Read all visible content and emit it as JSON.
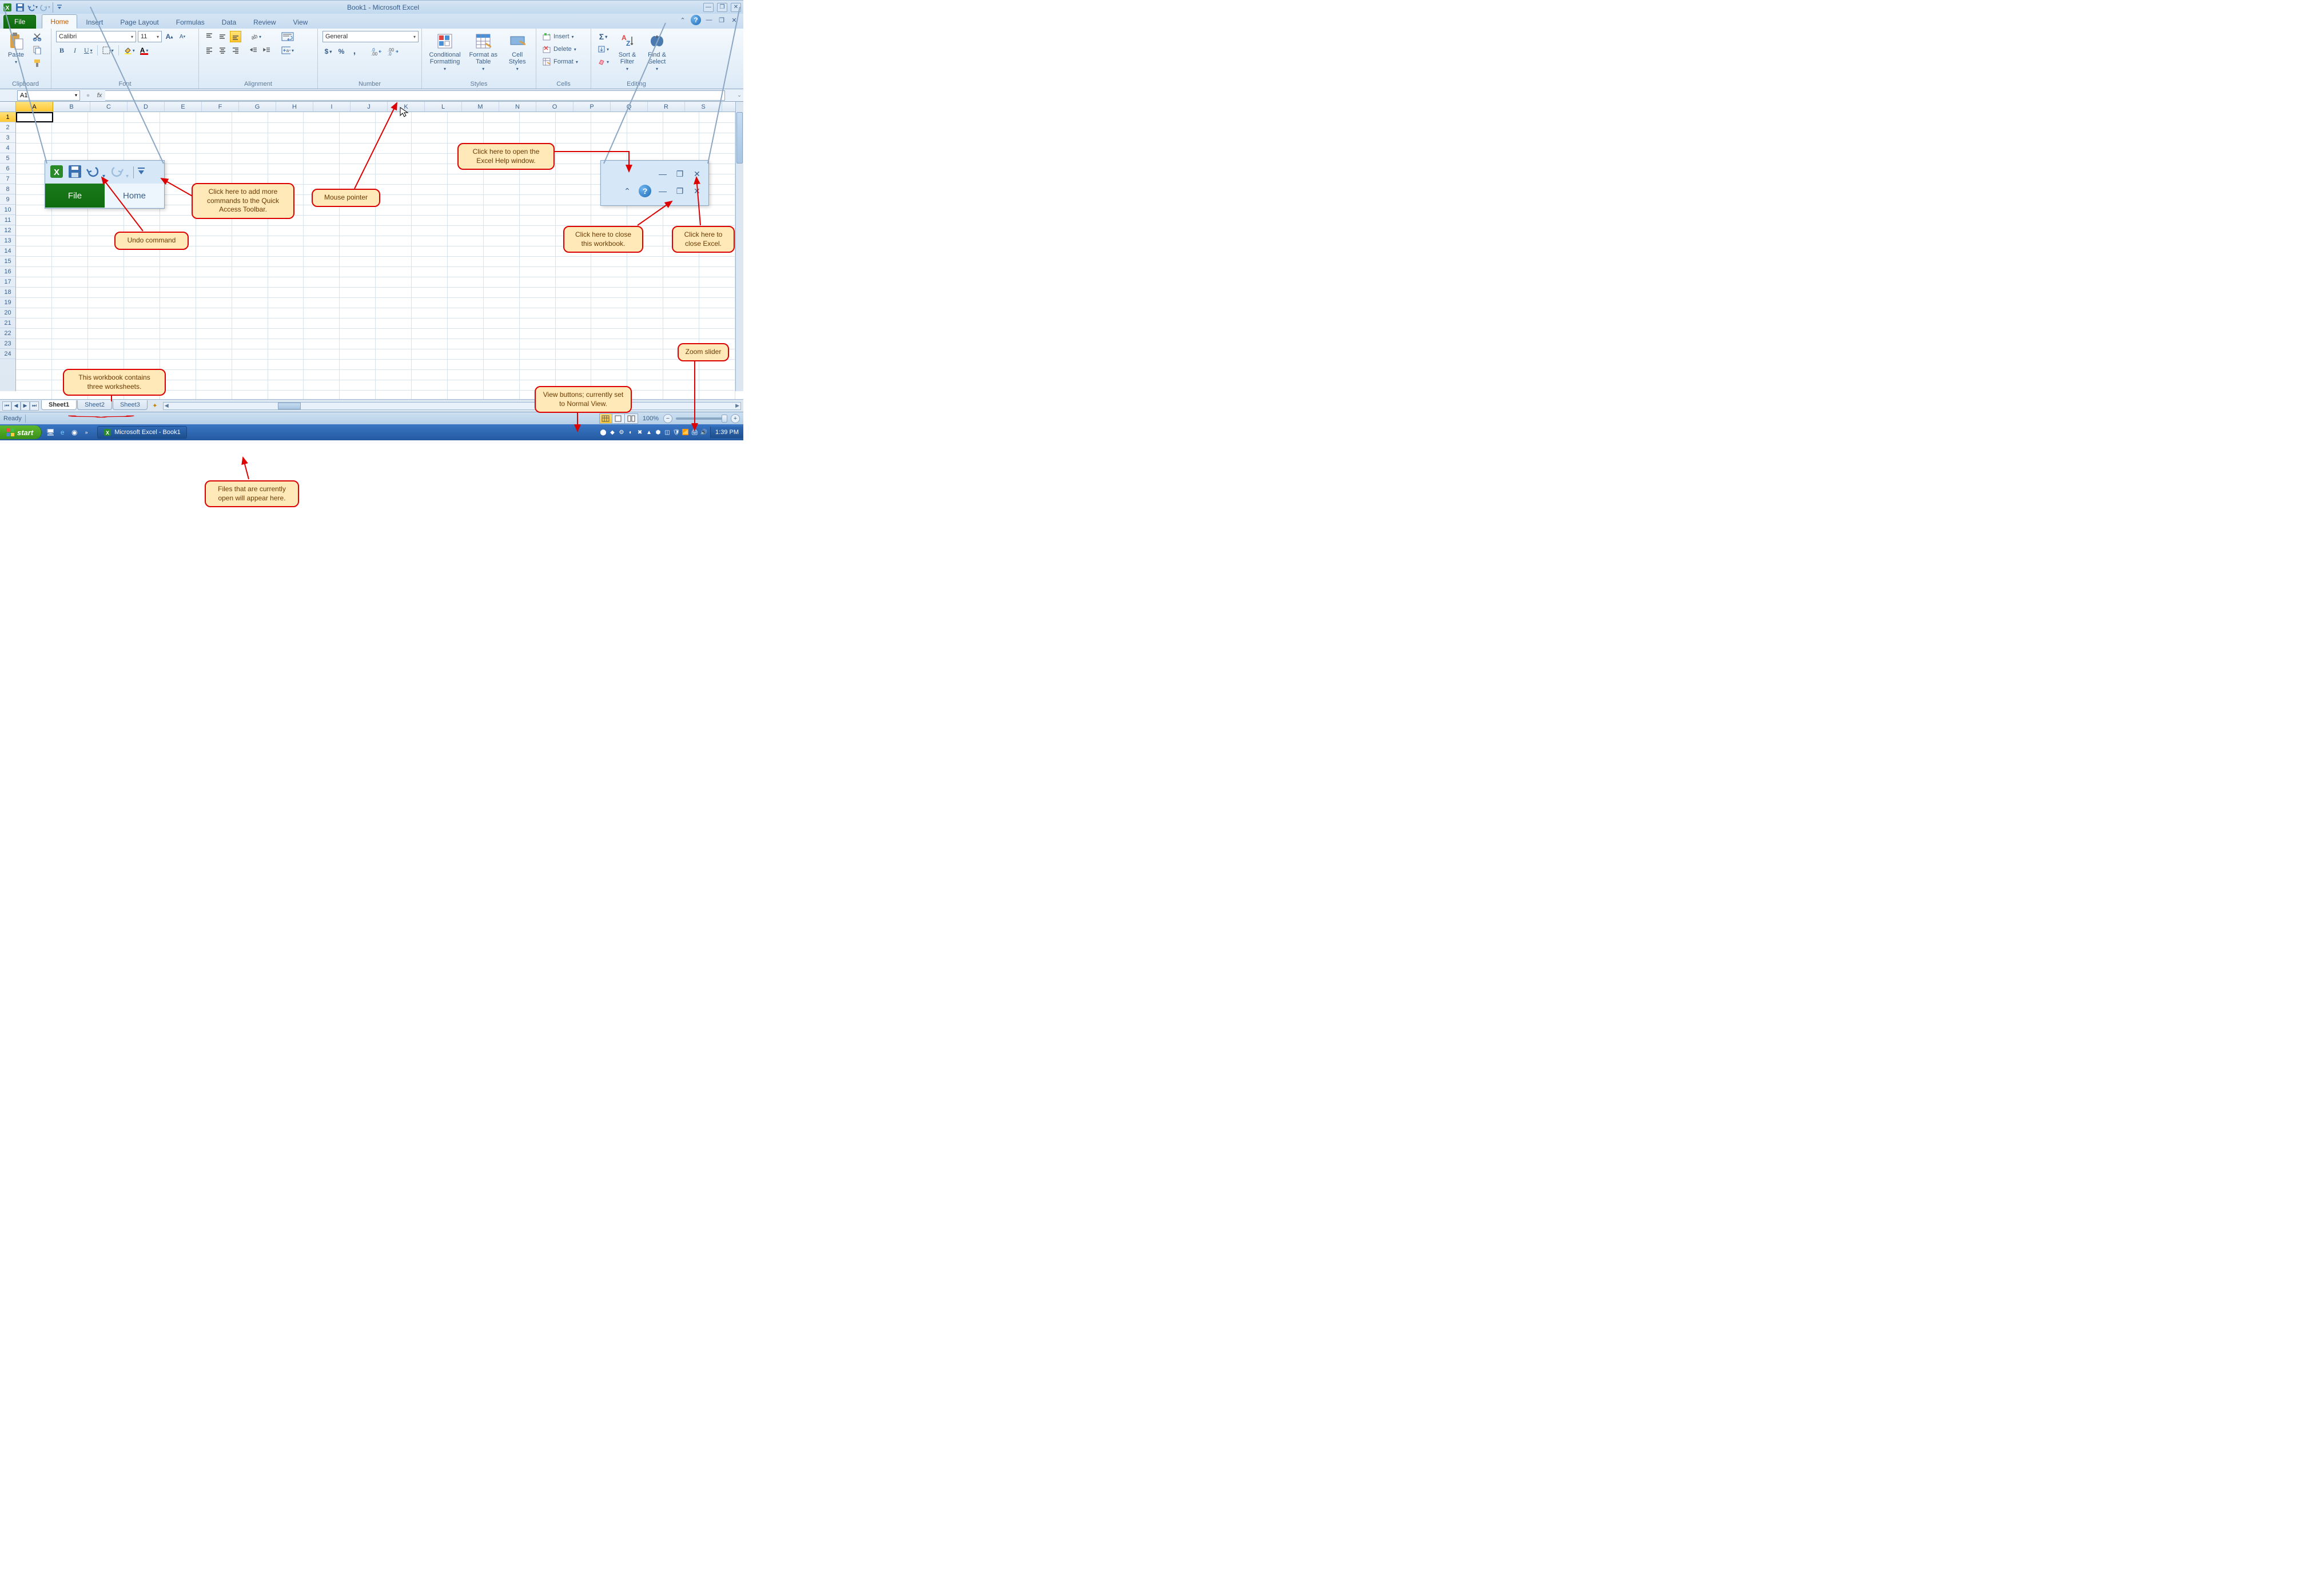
{
  "title": "Book1 - Microsoft Excel",
  "qat": {
    "save": "save-icon",
    "undo": "undo-icon",
    "redo": "redo-icon",
    "customize": "customize-qat-icon"
  },
  "tabs": {
    "file": "File",
    "items": [
      "Home",
      "Insert",
      "Page Layout",
      "Formulas",
      "Data",
      "Review",
      "View"
    ],
    "active": "Home"
  },
  "ribbon": {
    "clipboard": {
      "label": "Clipboard",
      "paste": "Paste"
    },
    "font": {
      "label": "Font",
      "name": "Calibri",
      "size": "11"
    },
    "alignment": {
      "label": "Alignment"
    },
    "number": {
      "label": "Number",
      "format": "General"
    },
    "styles": {
      "label": "Styles",
      "conditional": "Conditional Formatting",
      "table": "Format as Table",
      "cell": "Cell Styles"
    },
    "cells": {
      "label": "Cells",
      "insert": "Insert",
      "delete": "Delete",
      "format": "Format"
    },
    "editing": {
      "label": "Editing",
      "sort": "Sort & Filter",
      "find": "Find & Select"
    }
  },
  "namebox": "A1",
  "columns": [
    "A",
    "B",
    "C",
    "D",
    "E",
    "F",
    "G",
    "H",
    "I",
    "J",
    "K",
    "L",
    "M",
    "N",
    "O",
    "P",
    "Q",
    "R",
    "S"
  ],
  "rows": [
    "1",
    "2",
    "3",
    "4",
    "5",
    "6",
    "7",
    "8",
    "9",
    "10",
    "11",
    "12",
    "13",
    "14",
    "15",
    "16",
    "17",
    "18",
    "19",
    "20",
    "21",
    "22",
    "23",
    "24"
  ],
  "sheets": {
    "active": "Sheet1",
    "tabs": [
      "Sheet1",
      "Sheet2",
      "Sheet3"
    ]
  },
  "status": {
    "ready": "Ready",
    "zoom": "100%"
  },
  "taskbar": {
    "start": "start",
    "task": "Microsoft Excel - Book1",
    "clock": "1:39 PM"
  },
  "callouts": {
    "qat_customize": "Click here to add more commands to the Quick Access Toolbar.",
    "undo": "Undo command",
    "mouse": "Mouse pointer",
    "help": "Click here to open the Excel Help window.",
    "close_wb": "Click here to close this workbook.",
    "close_app": "Click here to close Excel.",
    "zoom": "Zoom slider",
    "views": "View buttons; currently set to Normal View.",
    "sheets": "This workbook contains three worksheets.",
    "open_files": "Files that are currently open will appear here."
  },
  "inset_tabs": {
    "file": "File",
    "home": "Home"
  }
}
